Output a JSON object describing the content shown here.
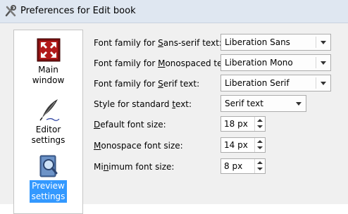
{
  "window": {
    "title": "Preferences for Edit book",
    "icon": "tools-icon"
  },
  "sidebar": {
    "items": [
      {
        "label_line1": "Main",
        "label_line2": "window",
        "icon": "fullscreen-arrows-icon",
        "selected": false
      },
      {
        "label_line1": "Editor",
        "label_line2": "settings",
        "icon": "quill-pen-icon",
        "selected": false
      },
      {
        "label_line1": "Preview",
        "label_line2": "settings",
        "icon": "book-magnifier-icon",
        "selected": true
      }
    ]
  },
  "form": {
    "sans_serif": {
      "label_pre": "Font family for ",
      "label_key": "S",
      "label_post": "ans-serif text:",
      "value": "Liberation Sans"
    },
    "monospaced": {
      "label_pre": "Font family for ",
      "label_key": "M",
      "label_post": "onospaced text:",
      "value": "Liberation Mono"
    },
    "serif": {
      "label_pre": "Font family for ",
      "label_key": "S",
      "label_post": "erif text:",
      "value": "Liberation Serif"
    },
    "standard": {
      "label_pre": "Style for standard ",
      "label_key": "t",
      "label_post": "ext:",
      "value": "Serif text"
    },
    "default_size": {
      "label_pre": "",
      "label_key": "D",
      "label_post": "efault font size:",
      "value": "18 px"
    },
    "mono_size": {
      "label_pre": "",
      "label_key": "M",
      "label_post": "onospace font size:",
      "value": "14 px"
    },
    "min_size": {
      "label_pre": "Mi",
      "label_key": "n",
      "label_post": "imum font size:",
      "value": "8 px"
    }
  }
}
